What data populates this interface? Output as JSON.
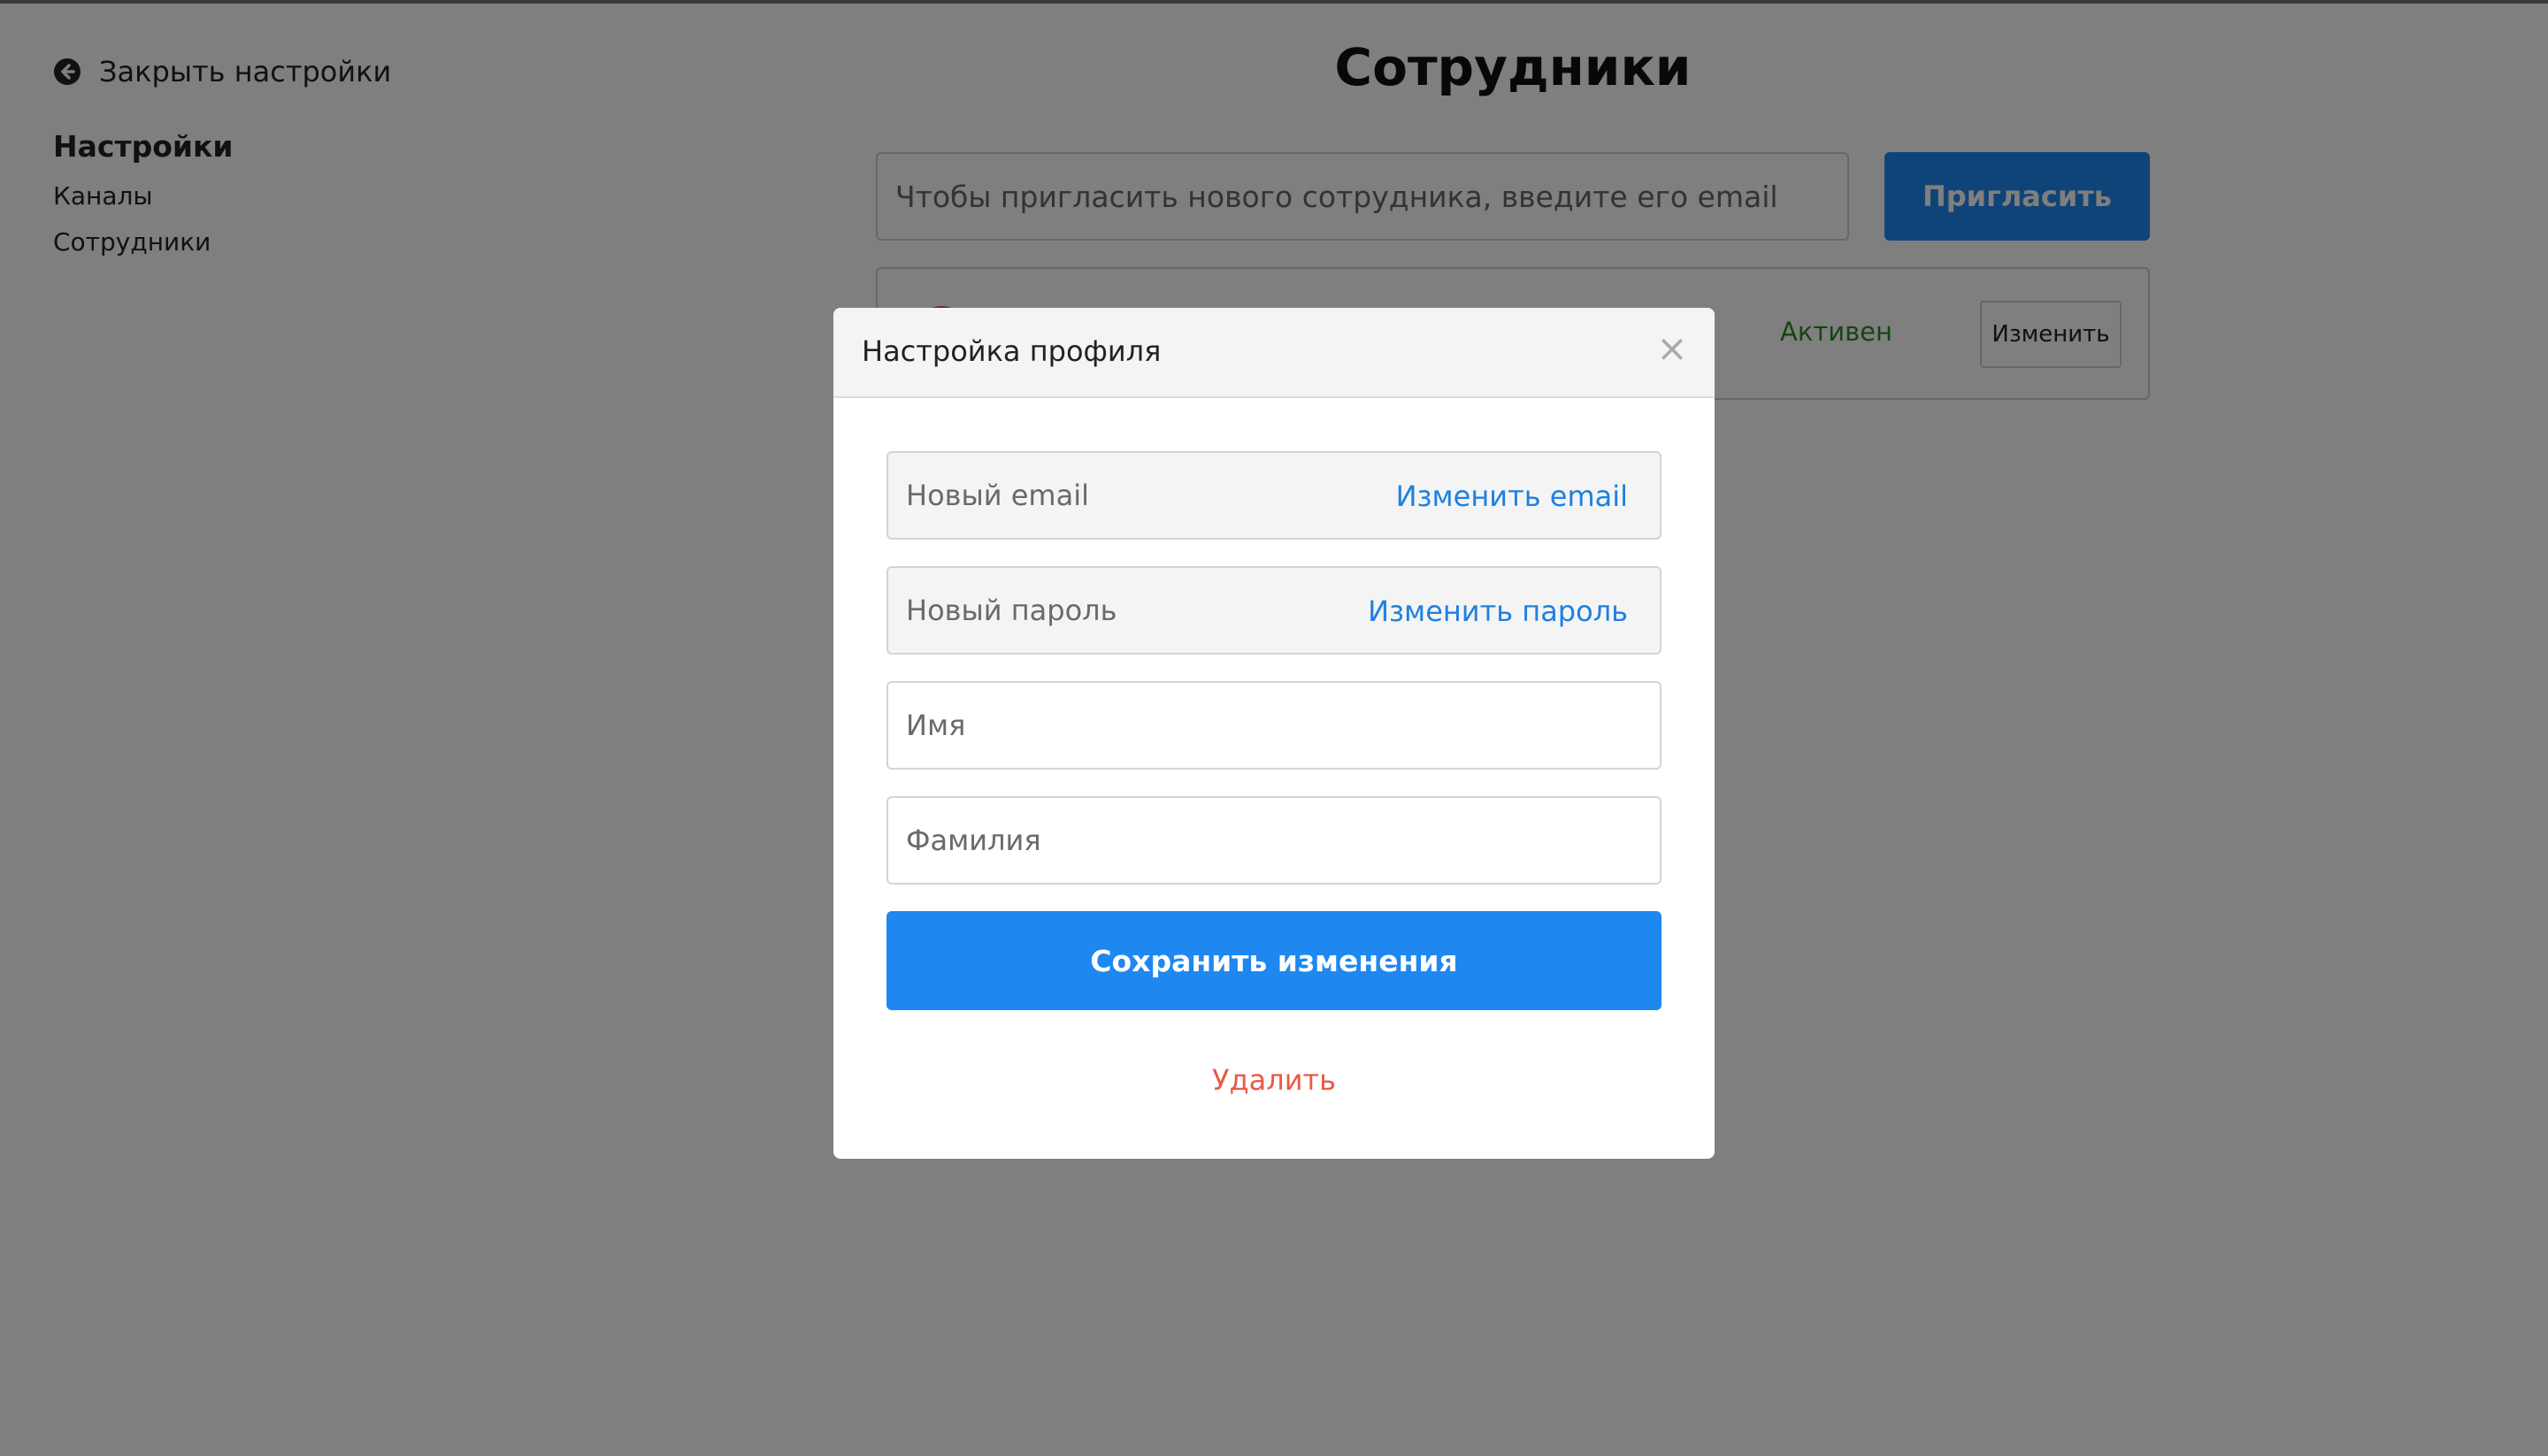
{
  "sidebar": {
    "close_label": "Закрыть настройки",
    "title": "Настройки",
    "items": [
      {
        "label": "Каналы"
      },
      {
        "label": "Сотрудники"
      }
    ]
  },
  "main": {
    "title": "Сотрудники",
    "invite_placeholder": "Чтобы пригласить нового сотрудника, введите его email",
    "invite_button": "Пригласить",
    "employee": {
      "status": "Активен",
      "edit_button": "Изменить"
    }
  },
  "modal": {
    "title": "Настройка профиля",
    "close_symbol": "×",
    "email_placeholder": "Новый email",
    "email_change": "Изменить email",
    "password_placeholder": "Новый пароль",
    "password_change": "Изменить пароль",
    "first_name_placeholder": "Имя",
    "last_name_placeholder": "Фамилия",
    "save_button": "Сохранить изменения",
    "delete_link": "Удалить"
  },
  "colors": {
    "accent": "#1e88f0",
    "link": "#1e80e0",
    "danger": "#e85a48",
    "status_active": "#2a8a22"
  }
}
